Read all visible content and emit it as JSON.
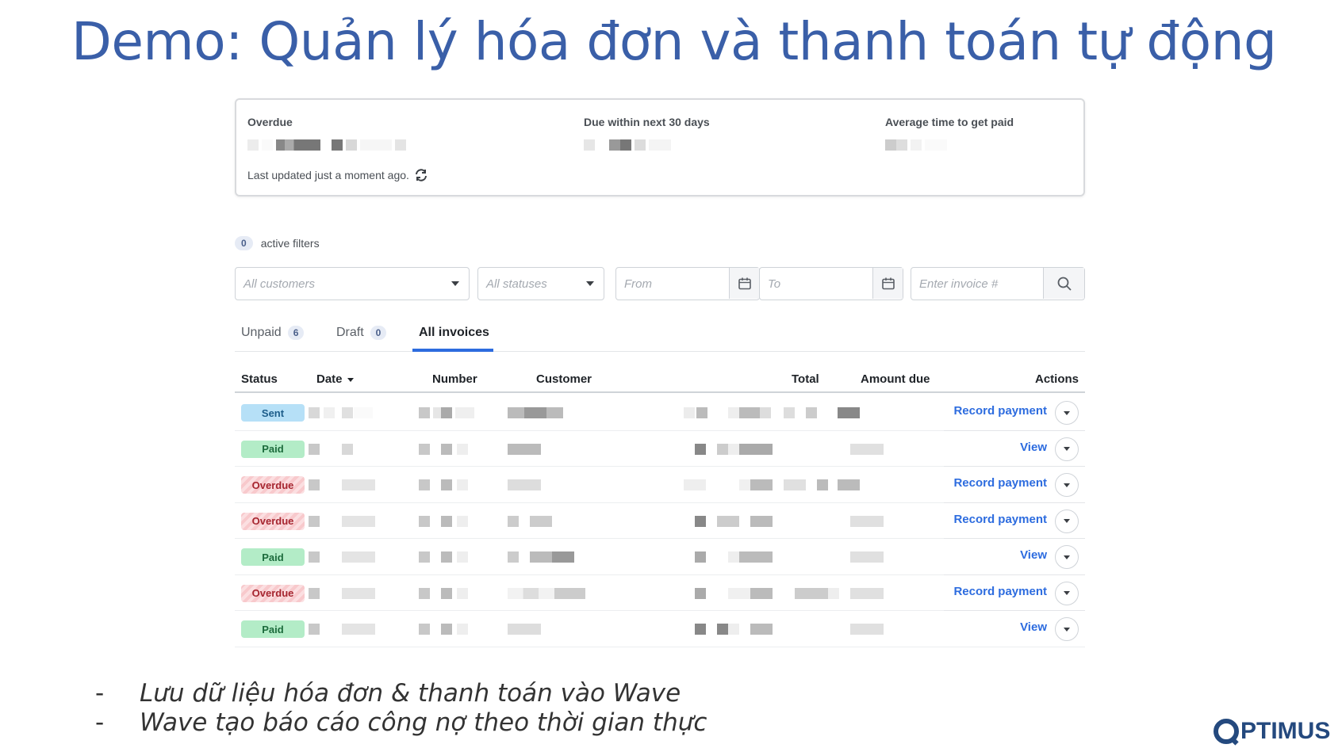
{
  "slide": {
    "title": "Demo: Quản lý hóa đơn và thanh toán tự động",
    "notes": [
      "Lưu dữ liệu hóa đơn & thanh  toán vào Wave",
      "Wave tạo báo cáo công nợ theo thời gian thực"
    ],
    "note_dash": "-",
    "logo_text": "PTIMUS"
  },
  "summary": {
    "overdue_label": "Overdue",
    "due_label": "Due within next 30 days",
    "avg_label": "Average time to get paid",
    "last_updated": "Last updated just a moment ago."
  },
  "filters": {
    "active_count": "0",
    "active_label": "active filters",
    "customers_placeholder": "All customers",
    "statuses_placeholder": "All statuses",
    "from_placeholder": "From",
    "to_placeholder": "To",
    "invoice_placeholder": "Enter invoice #"
  },
  "tabs": [
    {
      "label": "Unpaid",
      "count": "6"
    },
    {
      "label": "Draft",
      "count": "0"
    },
    {
      "label": "All invoices",
      "count": ""
    }
  ],
  "table": {
    "headers": {
      "status": "Status",
      "date": "Date",
      "number": "Number",
      "customer": "Customer",
      "total": "Total",
      "amount_due": "Amount due",
      "actions": "Actions"
    },
    "rows": [
      {
        "status": "Sent",
        "status_kind": "sent",
        "action": "Record payment"
      },
      {
        "status": "Paid",
        "status_kind": "paid",
        "action": "View"
      },
      {
        "status": "Overdue",
        "status_kind": "overdue",
        "action": "Record payment"
      },
      {
        "status": "Overdue",
        "status_kind": "overdue",
        "action": "Record payment"
      },
      {
        "status": "Paid",
        "status_kind": "paid",
        "action": "View"
      },
      {
        "status": "Overdue",
        "status_kind": "overdue",
        "action": "Record payment"
      },
      {
        "status": "Paid",
        "status_kind": "paid",
        "action": "View"
      }
    ]
  },
  "colors": {
    "title": "#3a5fa8",
    "link": "#2d6cdf",
    "sent_badge": "#b6e0f7",
    "paid_badge": "#b3ecc7",
    "overdue_badge": "#f8c9cc",
    "logo": "#24497e"
  },
  "icons": {
    "refresh": "refresh-icon",
    "calendar": "calendar-icon",
    "search": "search-icon",
    "dropdown": "chevron-down-icon"
  }
}
